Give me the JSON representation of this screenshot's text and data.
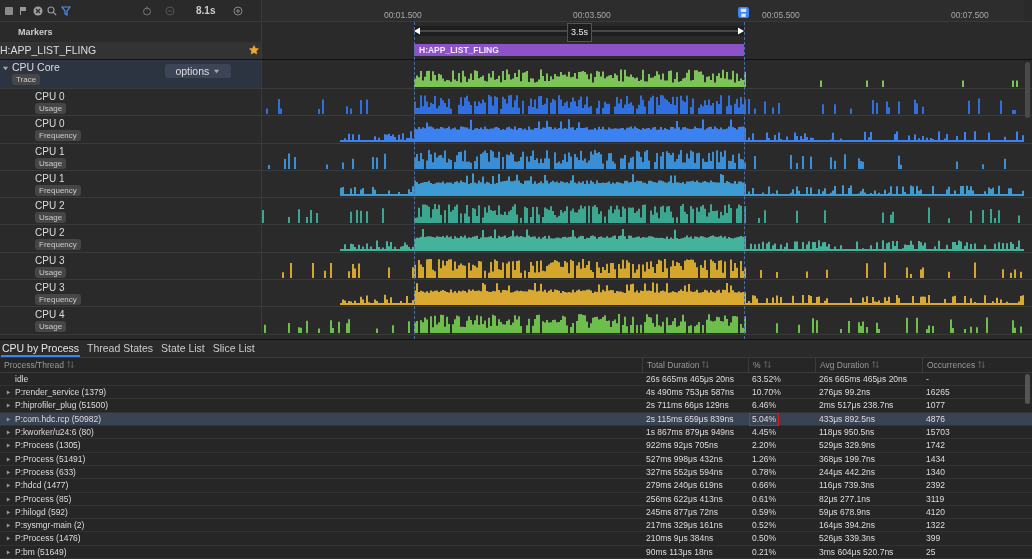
{
  "toolbar": {
    "zoom_label": "8.1s"
  },
  "timeline": {
    "ticks": [
      {
        "label": "00:01.500"
      },
      {
        "label": "00:03.500"
      },
      {
        "label": "00:05.500"
      },
      {
        "label": "00:07.500"
      }
    ],
    "range": {
      "label": "3.5s",
      "highlighted": true
    }
  },
  "markers": {
    "title": "Markers",
    "row_label": "H:APP_LIST_FLING",
    "starred": true,
    "slice_label": "H:APP_LIST_FLING"
  },
  "group": {
    "title": "CPU Core",
    "tag": "Trace",
    "expanded": true,
    "options_label": "options",
    "color": "#7cc455"
  },
  "tracks": [
    {
      "name": "CPU 0",
      "tag": "Usage",
      "kind": "usage",
      "color": "#2f6fe0"
    },
    {
      "name": "CPU 0",
      "tag": "Frequency",
      "kind": "frequency",
      "color": "#3b82f0"
    },
    {
      "name": "CPU 1",
      "tag": "Usage",
      "kind": "usage",
      "color": "#3a8ed6"
    },
    {
      "name": "CPU 1",
      "tag": "Frequency",
      "kind": "frequency",
      "color": "#3d9bd4"
    },
    {
      "name": "CPU 2",
      "tag": "Usage",
      "kind": "usage",
      "color": "#3aa890"
    },
    {
      "name": "CPU 2",
      "tag": "Frequency",
      "kind": "frequency",
      "color": "#45b39a"
    },
    {
      "name": "CPU 3",
      "tag": "Usage",
      "kind": "usage",
      "color": "#d4a72c"
    },
    {
      "name": "CPU 3",
      "tag": "Frequency",
      "kind": "frequency",
      "color": "#d9a931"
    },
    {
      "name": "CPU 4",
      "tag": "Usage",
      "kind": "usage",
      "color": "#6cbf4a"
    }
  ],
  "details": {
    "tabs": [
      {
        "label": "CPU by Process",
        "selected": true
      },
      {
        "label": "Thread States",
        "selected": false
      },
      {
        "label": "State List",
        "selected": false
      },
      {
        "label": "Slice List",
        "selected": false
      }
    ],
    "columns": [
      "Process/Thread",
      "Total Duration",
      "%",
      "Avg Duration",
      "Occurrences"
    ],
    "rows": [
      {
        "name": "idle",
        "expandable": false,
        "total": "26s 665ms 465μs 20ns",
        "percent": "63.52%",
        "avg": "26s 665ms 465μs 20ns",
        "occurrences": "-",
        "selected": false,
        "percent_highlighted": false
      },
      {
        "name": "P:render_service (1379)",
        "expandable": true,
        "total": "4s 490ms 753μs 587ns",
        "percent": "10.70%",
        "avg": "276μs 99.2ns",
        "occurrences": "16265",
        "selected": false,
        "percent_highlighted": false
      },
      {
        "name": "P:hiprofiler_plug (51500)",
        "expandable": true,
        "total": "2s 711ms 66μs 129ns",
        "percent": "6.46%",
        "avg": "2ms 517μs 238.7ns",
        "occurrences": "1077",
        "selected": false,
        "percent_highlighted": false
      },
      {
        "name": "P:com.hdc.rcp (50982)",
        "expandable": true,
        "total": "2s 115ms 659μs 839ns",
        "percent": "5.04%",
        "avg": "433μs 892.5ns",
        "occurrences": "4876",
        "selected": true,
        "percent_highlighted": true
      },
      {
        "name": "P:kworker/u24:6 (80)",
        "expandable": true,
        "total": "1s 867ms 879μs 949ns",
        "percent": "4.45%",
        "avg": "118μs 950.5ns",
        "occurrences": "15703",
        "selected": false,
        "percent_highlighted": false
      },
      {
        "name": "P:Process (1305)",
        "expandable": true,
        "total": "922ms 92μs 705ns",
        "percent": "2.20%",
        "avg": "529μs 329.9ns",
        "occurrences": "1742",
        "selected": false,
        "percent_highlighted": false
      },
      {
        "name": "P:Process (51491)",
        "expandable": true,
        "total": "527ms 998μs 432ns",
        "percent": "1.26%",
        "avg": "368μs 199.7ns",
        "occurrences": "1434",
        "selected": false,
        "percent_highlighted": false
      },
      {
        "name": "P:Process (633)",
        "expandable": true,
        "total": "327ms 552μs 594ns",
        "percent": "0.78%",
        "avg": "244μs 442.2ns",
        "occurrences": "1340",
        "selected": false,
        "percent_highlighted": false
      },
      {
        "name": "P:hdcd (1477)",
        "expandable": true,
        "total": "279ms 240μs 619ns",
        "percent": "0.66%",
        "avg": "116μs 739.3ns",
        "occurrences": "2392",
        "selected": false,
        "percent_highlighted": false
      },
      {
        "name": "P:Process (85)",
        "expandable": true,
        "total": "256ms 622μs 413ns",
        "percent": "0.61%",
        "avg": "82μs 277.1ns",
        "occurrences": "3119",
        "selected": false,
        "percent_highlighted": false
      },
      {
        "name": "P:hilogd (592)",
        "expandable": true,
        "total": "245ms 877μs 72ns",
        "percent": "0.59%",
        "avg": "59μs 678.9ns",
        "occurrences": "4120",
        "selected": false,
        "percent_highlighted": false
      },
      {
        "name": "P:sysmgr-main (2)",
        "expandable": true,
        "total": "217ms 329μs 161ns",
        "percent": "0.52%",
        "avg": "164μs 394.2ns",
        "occurrences": "1322",
        "selected": false,
        "percent_highlighted": false
      },
      {
        "name": "P:Process (1476)",
        "expandable": true,
        "total": "210ms 9μs 384ns",
        "percent": "0.50%",
        "avg": "526μs 339.3ns",
        "occurrences": "399",
        "selected": false,
        "percent_highlighted": false
      },
      {
        "name": "P:bm (51649)",
        "expandable": true,
        "total": "90ms 113μs 18ns",
        "percent": "0.21%",
        "avg": "3ms 604μs 520.7ns",
        "occurrences": "25",
        "selected": false,
        "percent_highlighted": false
      }
    ]
  }
}
